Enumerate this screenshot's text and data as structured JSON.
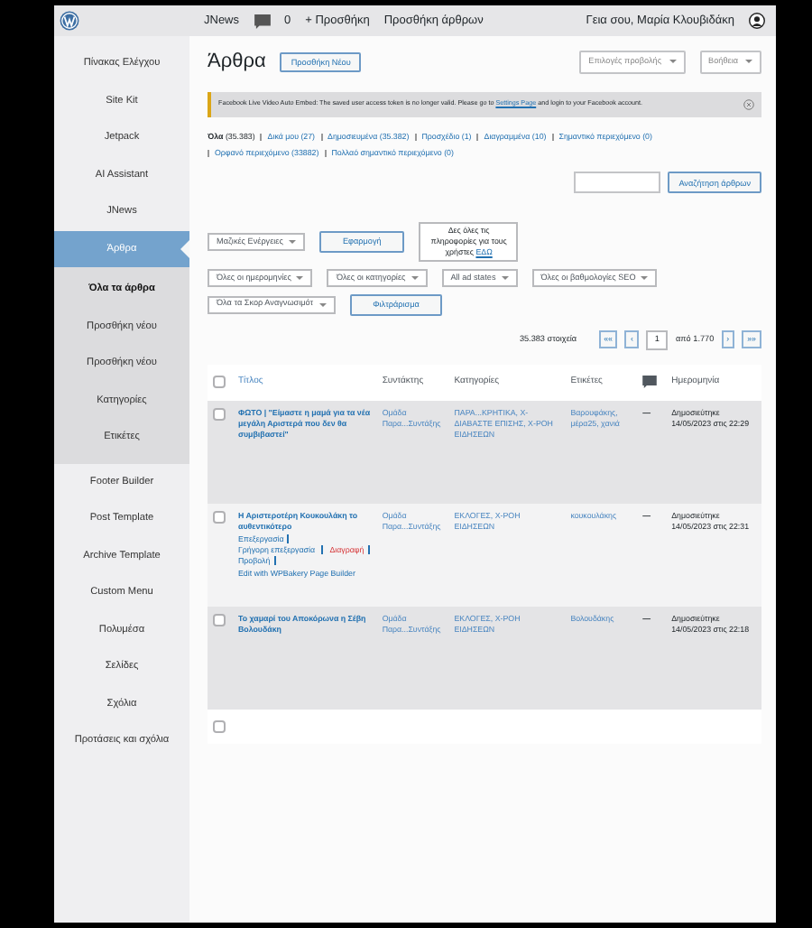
{
  "admin_bar": {
    "site": "JNews",
    "comments": "0",
    "new": "+ Προσθήκη",
    "add_posts": "Προσθήκη άρθρων",
    "greeting": "Γεια σου, Μαρία Κλουβιδάκη"
  },
  "sidebar": {
    "items": [
      {
        "label": "Πίνακας Ελέγχου",
        "selected": false
      },
      {
        "label": "Site Kit",
        "selected": false
      },
      {
        "label": "Jetpack",
        "selected": false
      },
      {
        "label": "AI Assistant",
        "selected": false
      },
      {
        "label": "JNews",
        "selected": false
      },
      {
        "label": "Άρθρα",
        "selected": true,
        "children": [
          {
            "label": "Όλα τα άρθρα",
            "selected": true
          },
          {
            "label": "Προσθήκη νέου",
            "selected": false
          },
          {
            "label": "Προσθήκη νέου",
            "selected": false
          },
          {
            "label": "Κατηγορίες",
            "selected": false
          },
          {
            "label": "Ετικέτες",
            "selected": false
          }
        ]
      },
      {
        "label": "Footer Builder",
        "selected": false
      },
      {
        "label": "Post Template",
        "selected": false
      },
      {
        "label": "Archive Template",
        "selected": false
      },
      {
        "label": "Custom Menu",
        "selected": false
      },
      {
        "label": "Πολυμέσα",
        "selected": false
      },
      {
        "label": "Σελίδες",
        "selected": false
      },
      {
        "label": "Σχόλια",
        "selected": false
      },
      {
        "label": "Προτάσεις και σχόλια",
        "selected": false
      }
    ]
  },
  "page": {
    "title": "Άρθρα",
    "add_new": "Προσθήκη Νέου",
    "screen_options": "Επιλογές προβολής",
    "help": "Βοήθεια"
  },
  "notice": {
    "text_before": "Facebook Live Video Auto Embed: The saved user access token is no longer valid. Please go to",
    "link": "Settings Page",
    "text_after": "and login to your Facebook account."
  },
  "status_links": [
    {
      "label": "Όλα",
      "count": "(35.383)",
      "selected": true
    },
    {
      "label": "Δικά μου",
      "count": "(27)",
      "selected": false
    },
    {
      "label": "Δημοσιευμένα",
      "count": "(35.382)",
      "selected": false
    },
    {
      "label": "Προσχέδιο",
      "count": "(1)",
      "selected": false
    },
    {
      "label": "Διαγραμμένα",
      "count": "(10)",
      "selected": false
    },
    {
      "label": "Σημαντικό περιεχόμενο",
      "count": "(0)",
      "selected": false
    },
    {
      "label": "Ορφανό περιεχόμενο",
      "count": "(33882)",
      "selected": false
    },
    {
      "label": "Πολλαό σημαντικό περιεχόμενο",
      "count": "(0)",
      "selected": false
    }
  ],
  "search": {
    "button": "Αναζήτηση άρθρων"
  },
  "filters": [
    [
      {
        "kind": "select",
        "label": "Μαζικές Ενέργειες"
      },
      {
        "kind": "button",
        "label": "Εφαρμογή"
      },
      {
        "kind": "info",
        "text": "Δες όλες τις πληροφορίες για τους χρήστες",
        "link": "ΕΔΩ"
      }
    ],
    [
      {
        "kind": "select",
        "label": "Όλες οι ημερομηνίες"
      },
      {
        "kind": "select",
        "label": "Όλες οι κατηγορίες"
      },
      {
        "kind": "select",
        "label": "All ad states"
      },
      {
        "kind": "select",
        "label": "Όλες οι βαθμολογίες SEO"
      }
    ],
    [
      {
        "kind": "select",
        "label": "Όλα τα Σκορ Αναγνωσιμότ"
      },
      {
        "kind": "button",
        "label": "Φιλτράρισμα"
      }
    ]
  ],
  "pagination": {
    "count": "35.383 στοιχεία",
    "first": "««",
    "prev": "‹",
    "page": "1",
    "of": "από 1.770",
    "next": "›",
    "last": "»»"
  },
  "table": {
    "columns": [
      {
        "kind": "text",
        "label": "Τίτλος"
      },
      {
        "kind": "text",
        "label": "Συντάκτης"
      },
      {
        "kind": "text",
        "label": "Κατηγορίες"
      },
      {
        "kind": "text",
        "label": "Ετικέτες"
      },
      {
        "kind": "icon"
      },
      {
        "kind": "text",
        "label": "Ημερομηνία"
      }
    ],
    "header_checked": false,
    "rows": [
      {
        "checked": false,
        "title": "ΦΩΤΟ | \"Είμαστε η μαμά για τα νέα μεγάλη Αριστερά που δεν θα συμβιβαστεί\"",
        "author": "Ομάδα Παρα...Συντάξης",
        "categories": "ΠΑΡΑ...ΚΡΗΤΙΚΑ, Χ-ΔΙΑΒΑΣΤΕ ΕΠΙΣΗΣ, Χ-ΡΟΗ ΕΙΔΗΣΕΩΝ",
        "tags": "Βαρουφάκης, μέρα25, χανιά",
        "comments": "—",
        "status": "Δημοσιεύτηκε",
        "date": "14/05/2023 στις 22:29"
      },
      {
        "checked": false,
        "title": "Η Αριστεροτέρη Κουκουλάκη το αυθεντικότερο",
        "actions": [
          {
            "kind": "link",
            "label": "Επεξεργασία"
          },
          {
            "kind": "link",
            "label": "Γρήγορη επεξεργασία"
          },
          {
            "kind": "danger",
            "label": "Διαγραφή"
          },
          {
            "kind": "link",
            "label": "Προβολή"
          },
          {
            "kind": "link",
            "label": "Edit with WPBakery Page Builder"
          }
        ],
        "author": "Ομάδα Παρα...Συντάξης",
        "categories": "ΕΚΛΟΓΕΣ, Χ-ΡΟΗ ΕΙΔΗΣΕΩΝ",
        "tags": "κουκουλάκης",
        "comments": "—",
        "status": "Δημοσιεύτηκε",
        "date": "14/05/2023 στις 22:31"
      },
      {
        "checked": false,
        "title": "Το χαμαρί του Αποκόρωνα η Σέβη Βολουδάκη",
        "author": "Ομάδα Παρα...Συντάξης",
        "categories": "ΕΚΛΟΓΕΣ, Χ-ΡΟΗ ΕΙΔΗΣΕΩΝ",
        "tags": "Βολουδάκης",
        "comments": "—",
        "status": "Δημοσιεύτηκε",
        "date": "14/05/2023 στις 22:18"
      }
    ],
    "footer_checked": false
  }
}
